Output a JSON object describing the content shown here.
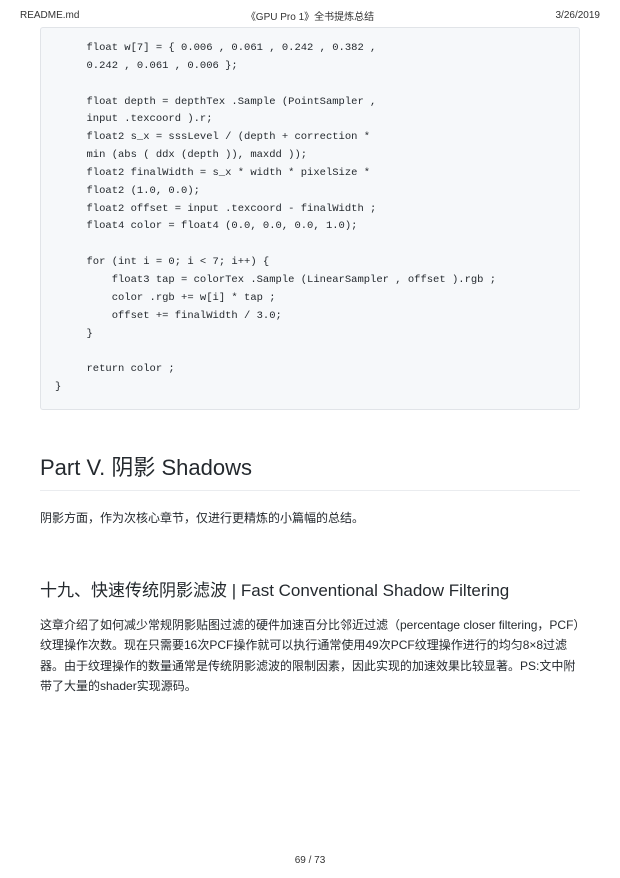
{
  "header": {
    "file": "README.md",
    "title": "《GPU Pro 1》全书提炼总结",
    "date": "3/26/2019"
  },
  "code": "     float w[7] = { 0.006 , 0.061 , 0.242 , 0.382 ,\n     0.242 , 0.061 , 0.006 };\n\n     float depth = depthTex .Sample (PointSampler ,\n     input .texcoord ).r;\n     float2 s_x = sssLevel / (depth + correction *\n     min (abs ( ddx (depth )), maxdd ));\n     float2 finalWidth = s_x * width * pixelSize *\n     float2 (1.0, 0.0);\n     float2 offset = input .texcoord - finalWidth ;\n     float4 color = float4 (0.0, 0.0, 0.0, 1.0);\n\n     for (int i = 0; i < 7; i++) {\n         float3 tap = colorTex .Sample (LinearSampler , offset ).rgb ;\n         color .rgb += w[i] * tap ;\n         offset += finalWidth / 3.0;\n     }\n\n     return color ;\n}",
  "part": {
    "heading": "Part V. 阴影 Shadows",
    "intro": "阴影方面，作为次核心章节，仅进行更精炼的小篇幅的总结。"
  },
  "chapter": {
    "heading": "十九、快速传统阴影滤波 | Fast Conventional Shadow Filtering",
    "body": "这章介绍了如何减少常规阴影贴图过滤的硬件加速百分比邻近过滤（percentage closer filtering，PCF）纹理操作次数。现在只需要16次PCF操作就可以执行通常使用49次PCF纹理操作进行的均匀8×8过滤器。由于纹理操作的数量通常是传统阴影滤波的限制因素，因此实现的加速效果比较显著。PS:文中附带了大量的shader实现源码。"
  },
  "footer": {
    "page": "69 / 73"
  }
}
